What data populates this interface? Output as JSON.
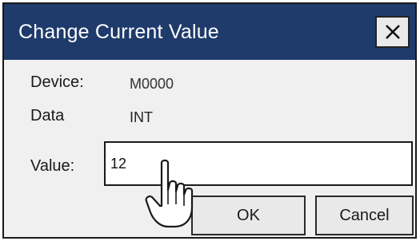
{
  "dialog": {
    "title": "Change Current Value",
    "close_icon": "close-icon"
  },
  "fields": {
    "device_label": "Device:",
    "device_value": "M0000",
    "data_label": "Data",
    "data_value": "INT",
    "value_label": "Value:",
    "value_input": "12"
  },
  "buttons": {
    "ok_label": "OK",
    "cancel_label": "Cancel"
  },
  "cursor": {
    "icon": "hand-pointer-icon"
  },
  "colors": {
    "titlebar": "#1f3b6b",
    "dialog_background": "#f0f0f0"
  }
}
